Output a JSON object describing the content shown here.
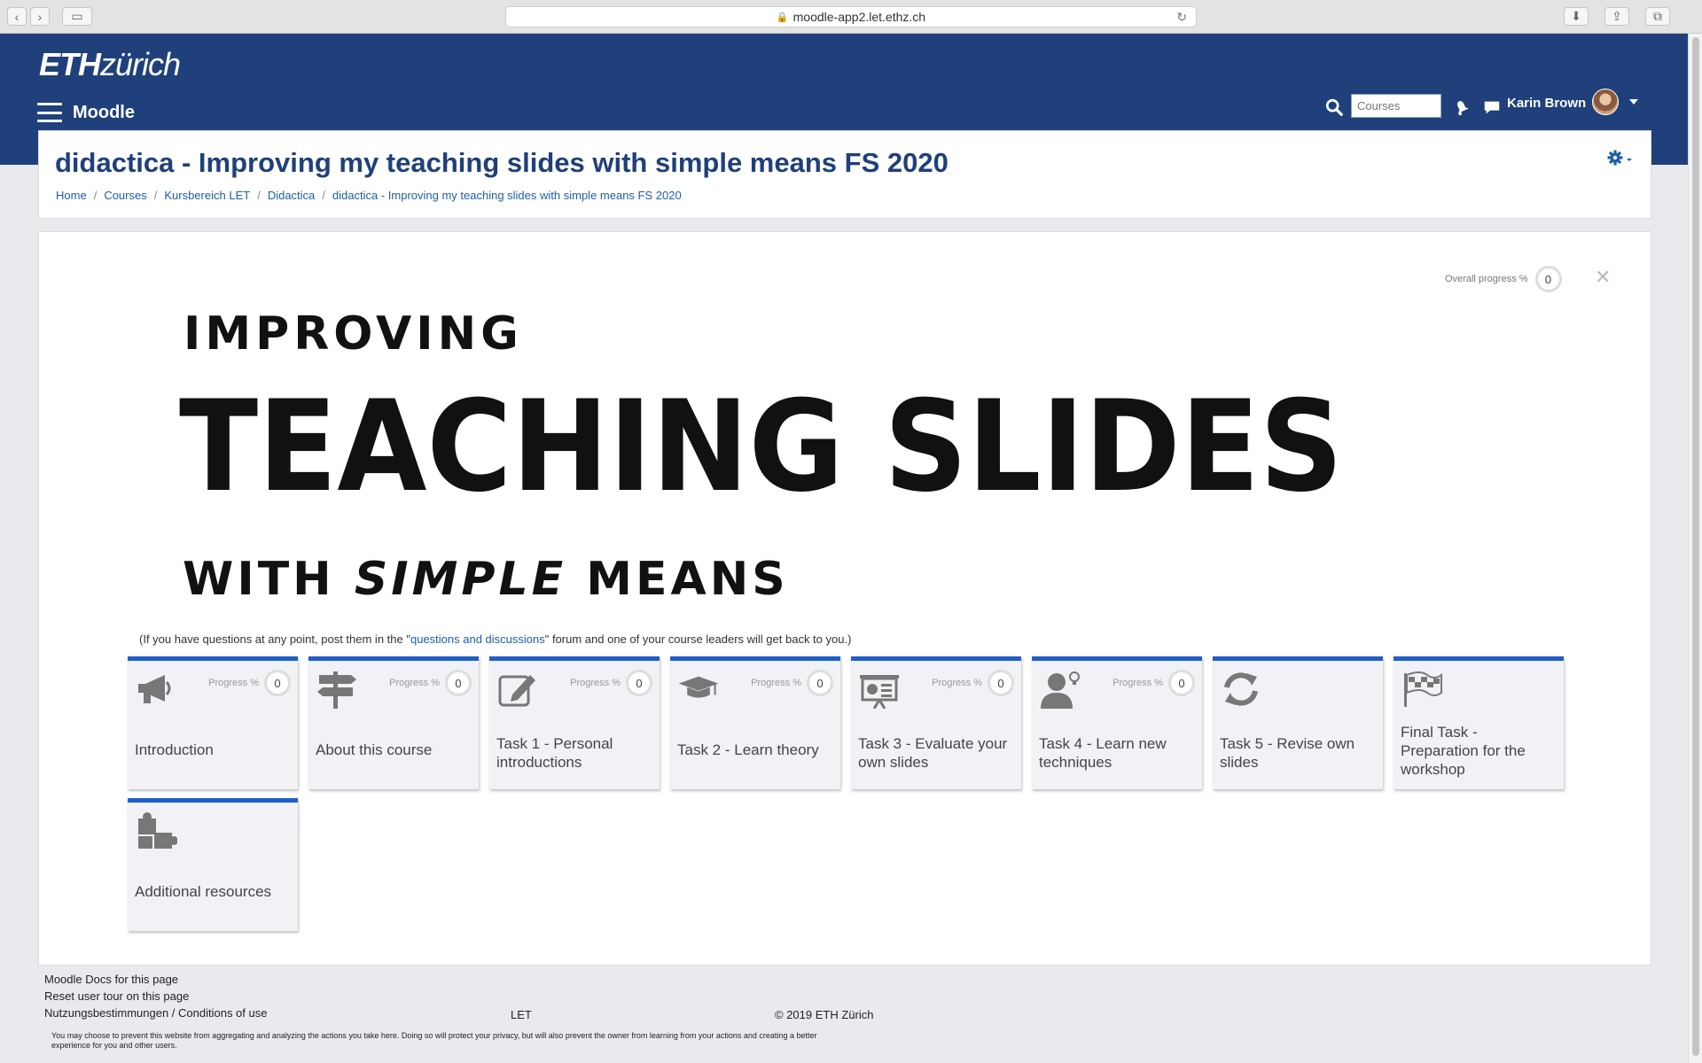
{
  "browser": {
    "url": "moodle-app2.let.ethz.ch"
  },
  "header": {
    "logo_bold": "ETH",
    "logo_light": "zürich",
    "brand": "Moodle",
    "search_placeholder": "Courses",
    "user_name": "Karin Brown"
  },
  "course": {
    "title": "didactica - Improving my teaching slides with simple means FS 2020",
    "breadcrumb": [
      "Home",
      "Courses",
      "Kursbereich LET",
      "Didactica",
      "didactica - Improving my teaching slides with simple means FS 2020"
    ]
  },
  "main": {
    "overall_progress_label": "Overall progress %",
    "overall_progress_value": "0",
    "banner_line1": "IMPROVING",
    "banner_line2": "TEACHING SLIDES",
    "banner_line3_a": "WITH ",
    "banner_line3_b": "SIMPLE",
    "banner_line3_c": " MEANS",
    "note_before": "(If you have questions at any point, post them in the \"",
    "note_link": "questions and discussions",
    "note_after": "\" forum and one of your course leaders will get back to you.)",
    "progress_label": "Progress %",
    "tiles": [
      {
        "label": "Introduction",
        "icon": "megaphone-icon",
        "progress": "0"
      },
      {
        "label": "About this course",
        "icon": "signpost-icon",
        "progress": "0"
      },
      {
        "label": "Task 1 - Personal introductions",
        "icon": "pencil-edit-icon",
        "progress": "0"
      },
      {
        "label": "Task 2 - Learn theory",
        "icon": "graduation-cap-icon",
        "progress": "0"
      },
      {
        "label": "Task 3 - Evaluate your own slides",
        "icon": "presentation-icon",
        "progress": "0"
      },
      {
        "label": "Task 4 - Learn new techniques",
        "icon": "person-idea-icon",
        "progress": "0"
      },
      {
        "label": "Task 5 - Revise own slides",
        "icon": "refresh-icon",
        "progress": null
      },
      {
        "label": "Final Task - Preparation for the workshop",
        "icon": "checkered-flag-icon",
        "progress": null
      },
      {
        "label": "Additional resources",
        "icon": "puzzle-icon",
        "progress": null
      }
    ]
  },
  "footer": {
    "docs": "Moodle Docs for this page",
    "tour": "Reset user tour on this page",
    "terms": "Nutzungsbestimmungen / Conditions of use",
    "let": "LET",
    "copyright": "© 2019 ETH Zürich",
    "privacy": "You may choose to prevent this website from aggregating and analyzing the actions you take here. Doing so will protect your privacy, but will also prevent the owner from learning from your actions and creating a better experience for you and other users."
  }
}
